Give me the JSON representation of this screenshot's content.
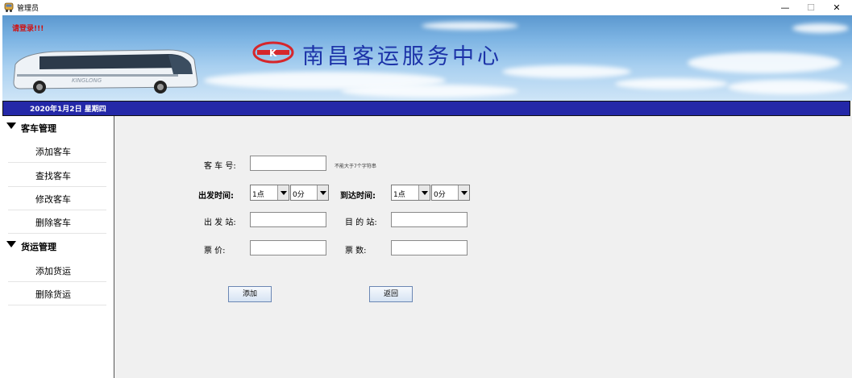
{
  "window": {
    "title": "管理员",
    "minimize": "—",
    "maximize": "☐",
    "close": "✕"
  },
  "banner": {
    "login_warning": "请登录!!!",
    "title": "南昌客运服务中心",
    "logo_text": "K"
  },
  "datebar": {
    "date": "2020年1月2日  星期四"
  },
  "sidebar": {
    "groups": [
      {
        "label": "客车管理",
        "items": [
          "添加客车",
          "查找客车",
          "修改客车",
          "删除客车"
        ]
      },
      {
        "label": "货运管理",
        "items": [
          "添加货运",
          "删除货运"
        ]
      }
    ]
  },
  "form": {
    "bus_no_label": "客  车  号:",
    "bus_no_value": "",
    "bus_no_hint": "不能大于7个字符串",
    "depart_time_label": "出发时间:",
    "depart_hour": "1点",
    "depart_minute": "0分",
    "arrive_time_label": "到达时间:",
    "arrive_hour": "1点",
    "arrive_minute": "0分",
    "start_station_label": "出  发  站:",
    "start_station_value": "",
    "dest_station_label": "目  的  站:",
    "dest_station_value": "",
    "price_label": "票        价:",
    "price_value": "",
    "count_label": "票        数:",
    "count_value": "",
    "add_button": "添加",
    "back_button": "返回"
  },
  "colors": {
    "banner_title": "#1c33a8",
    "date_bar": "#2428a8",
    "warning": "#d01010"
  }
}
